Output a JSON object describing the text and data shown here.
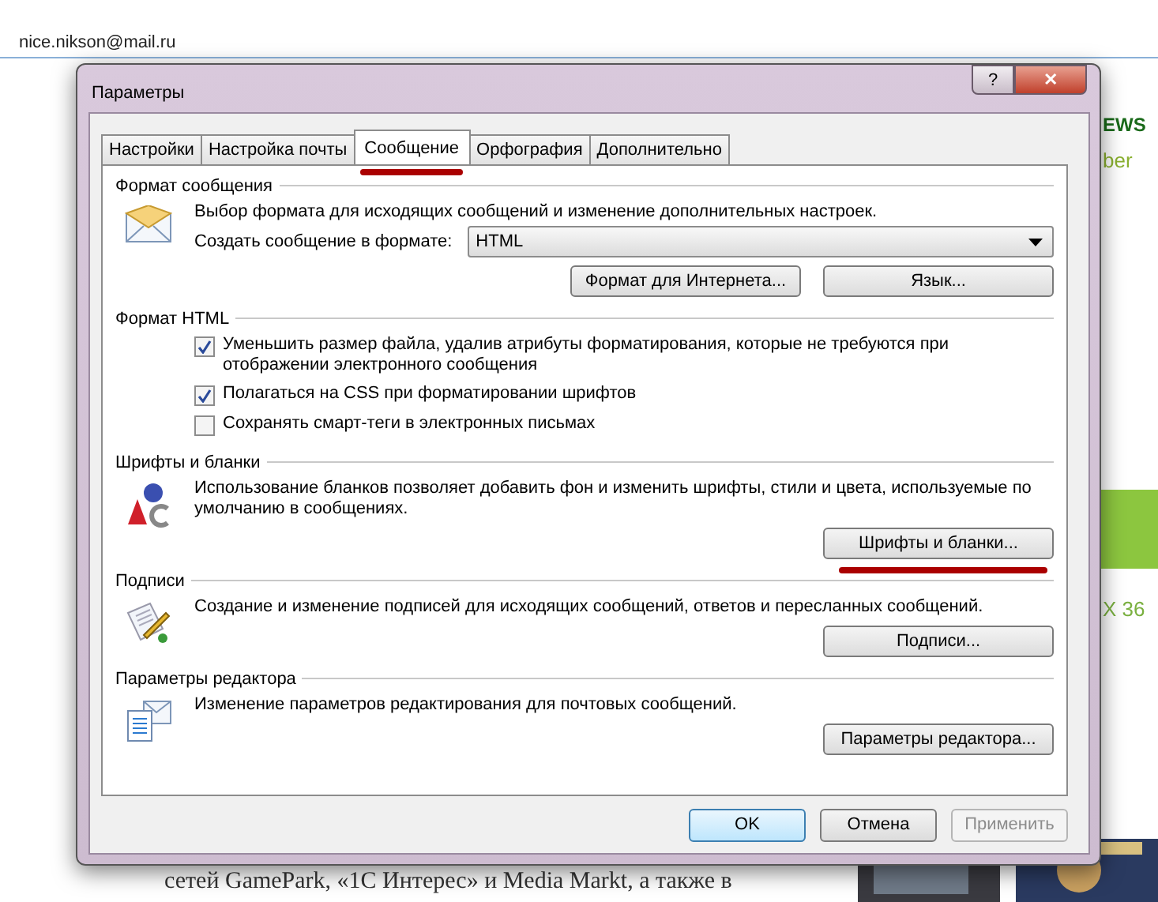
{
  "background": {
    "email": "nice.nikson@mail.ru",
    "ad_texts": [
      "EWS",
      "ber",
      "X 36"
    ],
    "article_line": "сетей GamePark, «1С Интерес» и Media Markt, а также в"
  },
  "window": {
    "title": "Параметры",
    "help_glyph": "?",
    "close_glyph": "✕",
    "tabs": [
      {
        "label": "Настройки",
        "selected": false
      },
      {
        "label": "Настройка почты",
        "selected": false
      },
      {
        "label": "Сообщение",
        "selected": true,
        "underlined": true
      },
      {
        "label": "Орфография",
        "selected": false
      },
      {
        "label": "Дополнительно",
        "selected": false
      }
    ],
    "sections": [
      {
        "kind": "format",
        "title": "Формат сообщения",
        "description": "Выбор формата для исходящих сообщений и изменение дополнительных настроек.",
        "format_label": "Создать сообщение в формате:",
        "format_value": "HTML",
        "buttons": [
          {
            "label": "Формат для Интернета..."
          },
          {
            "label": "Язык..."
          }
        ]
      },
      {
        "kind": "html",
        "title": "Формат HTML",
        "checkboxes": [
          {
            "label": "Уменьшить размер файла, удалив атрибуты форматирования, которые не требуются при отображении электронного сообщения",
            "checked": true
          },
          {
            "label": "Полагаться на CSS при форматировании шрифтов",
            "checked": true
          },
          {
            "label": "Сохранять смарт-теги в электронных письмах",
            "checked": false
          }
        ]
      },
      {
        "kind": "stationery",
        "title": "Шрифты и бланки",
        "description": "Использование бланков позволяет добавить фон и изменить шрифты, стили и цвета, используемые по умолчанию в сообщениях.",
        "buttons": [
          {
            "label": "Шрифты и бланки...",
            "underlined": true
          }
        ]
      },
      {
        "kind": "signatures",
        "title": "Подписи",
        "description": "Создание и изменение подписей для исходящих сообщений, ответов и пересланных сообщений.",
        "buttons": [
          {
            "label": "Подписи..."
          }
        ]
      },
      {
        "kind": "editor",
        "title": "Параметры редактора",
        "description": "Изменение параметров редактирования для почтовых сообщений.",
        "buttons": [
          {
            "label": "Параметры редактора..."
          }
        ]
      }
    ],
    "footer_buttons": [
      {
        "label": "OK",
        "kind": "default"
      },
      {
        "label": "Отмена",
        "kind": "normal"
      },
      {
        "label": "Применить",
        "kind": "disabled"
      }
    ]
  }
}
